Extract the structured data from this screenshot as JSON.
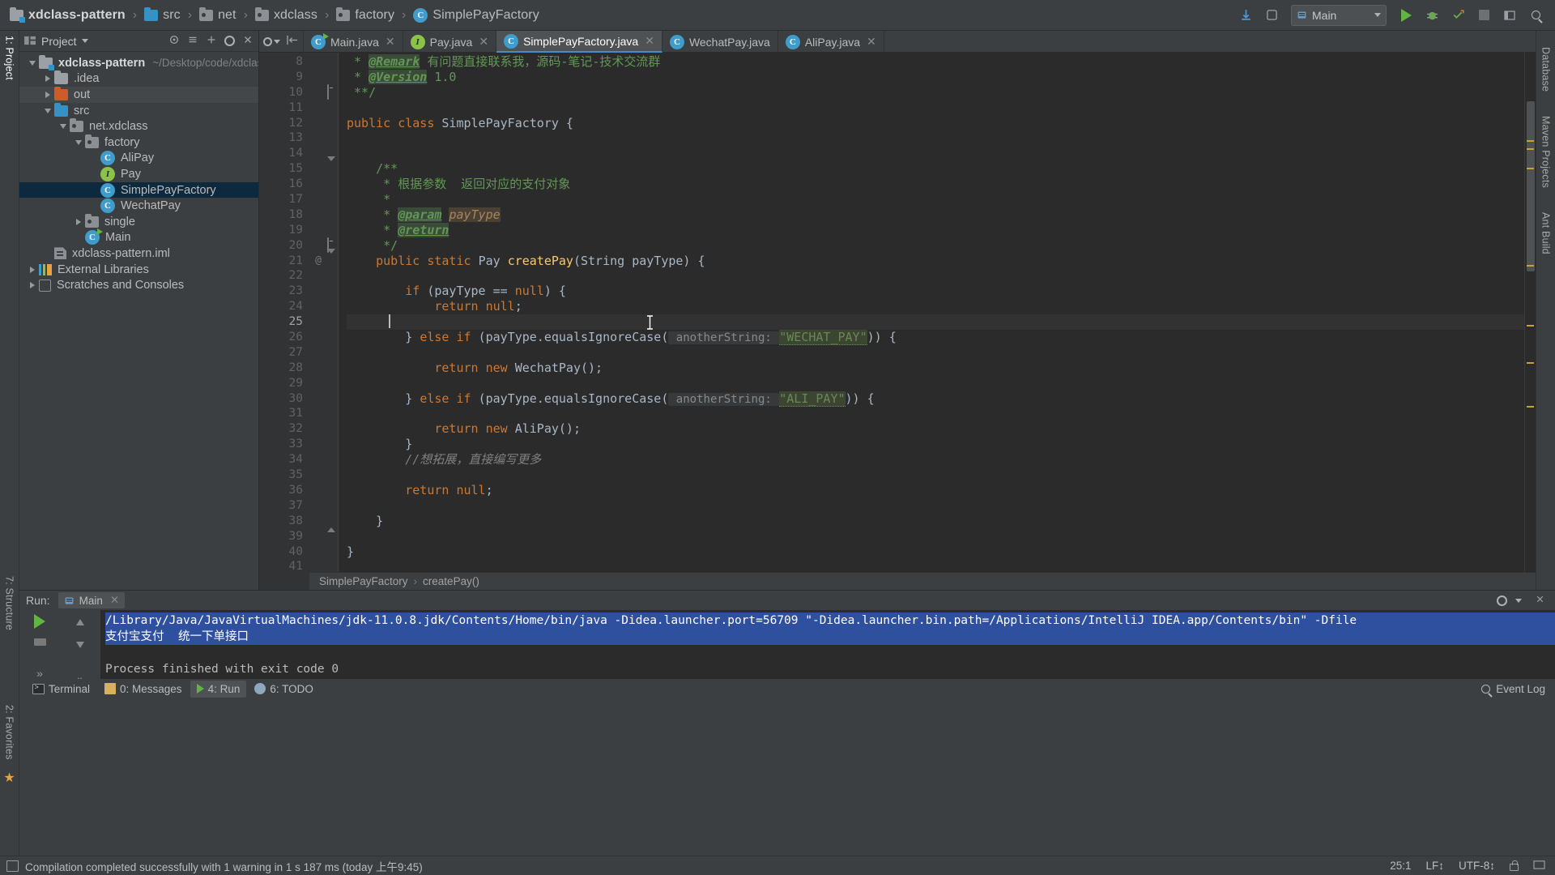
{
  "navbar": {
    "breadcrumbs": [
      {
        "label": "xdclass-pattern",
        "icon": "module-folder-icon"
      },
      {
        "label": "src",
        "icon": "source-folder-icon"
      },
      {
        "label": "net",
        "icon": "package-icon"
      },
      {
        "label": "xdclass",
        "icon": "package-icon"
      },
      {
        "label": "factory",
        "icon": "package-icon"
      },
      {
        "label": "SimplePayFactory",
        "icon": "class-icon"
      }
    ],
    "separator": "›",
    "run_config": "Main",
    "icons": [
      "update-project-icon",
      "vcs-icon",
      "run-icon",
      "debug-icon",
      "coverage-icon",
      "stop-icon",
      "layout-icon",
      "search-everywhere-icon"
    ]
  },
  "stripes": {
    "left": [
      "1: Project",
      "7: Structure",
      "2: Favorites"
    ],
    "right": [
      "Database",
      "Maven Projects",
      "Ant Build"
    ]
  },
  "project_panel": {
    "title": "Project",
    "tools": [
      "collapse-all-icon",
      "expand-icon",
      "settings-icon",
      "hide-icon"
    ],
    "tree": [
      {
        "label": "xdclass-pattern",
        "path": "~/Desktop/code/xdclass-patt",
        "icon": "module-folder-icon",
        "twisty": "down",
        "indent": 0,
        "bold": true,
        "state": "none"
      },
      {
        "label": ".idea",
        "icon": "folder-grey-icon",
        "twisty": "right",
        "indent": 1,
        "state": "none"
      },
      {
        "label": "out",
        "icon": "folder-orange-icon",
        "twisty": "right",
        "indent": 1,
        "state": "hover"
      },
      {
        "label": "src",
        "icon": "folder-blue-icon",
        "twisty": "down",
        "indent": 1,
        "state": "none"
      },
      {
        "label": "net.xdclass",
        "icon": "package-icon",
        "twisty": "down",
        "indent": 2,
        "state": "none"
      },
      {
        "label": "factory",
        "icon": "package-icon",
        "twisty": "down",
        "indent": 3,
        "state": "none"
      },
      {
        "label": "AliPay",
        "icon": "class-icon",
        "twisty": "none",
        "indent": 4,
        "state": "none"
      },
      {
        "label": "Pay",
        "icon": "interface-icon",
        "twisty": "none",
        "indent": 4,
        "state": "none"
      },
      {
        "label": "SimplePayFactory",
        "icon": "class-icon",
        "twisty": "none",
        "indent": 4,
        "state": "selected"
      },
      {
        "label": "WechatPay",
        "icon": "class-icon",
        "twisty": "none",
        "indent": 4,
        "state": "none"
      },
      {
        "label": "single",
        "icon": "package-icon",
        "twisty": "right",
        "indent": 3,
        "state": "none"
      },
      {
        "label": "Main",
        "icon": "class-runnable-icon",
        "twisty": "none",
        "indent": 3,
        "state": "none"
      },
      {
        "label": "xdclass-pattern.iml",
        "icon": "iml-file-icon",
        "twisty": "none",
        "indent": 1,
        "state": "none"
      },
      {
        "label": "External Libraries",
        "icon": "library-icon",
        "twisty": "right",
        "indent": 0,
        "state": "none"
      },
      {
        "label": "Scratches and Consoles",
        "icon": "scratch-icon",
        "twisty": "right",
        "indent": 0,
        "state": "none"
      }
    ]
  },
  "editor": {
    "tabs": [
      {
        "label": "Main.java",
        "icon": "class-runnable-icon",
        "active": false,
        "closable": true
      },
      {
        "label": "Pay.java",
        "icon": "interface-icon",
        "active": false,
        "closable": true
      },
      {
        "label": "SimplePayFactory.java",
        "icon": "class-icon",
        "active": true,
        "closable": true
      },
      {
        "label": "WechatPay.java",
        "icon": "class-icon",
        "active": false,
        "closable": false
      },
      {
        "label": "AliPay.java",
        "icon": "class-icon",
        "active": false,
        "closable": true
      }
    ],
    "first_line_number": 8,
    "lines": [
      {
        "n": 8,
        "annot": "",
        "fold": "",
        "tokens": [
          {
            "t": " * ",
            "c": "cmt"
          },
          {
            "t": "@Remark",
            "c": "cmt-tag"
          },
          {
            "t": " 有问题直接联系我，源码-笔记-技术交流群",
            "c": "cmt"
          }
        ]
      },
      {
        "n": 9,
        "annot": "",
        "fold": "",
        "tokens": [
          {
            "t": " * ",
            "c": "cmt"
          },
          {
            "t": "@Version",
            "c": "cmt-tag"
          },
          {
            "t": " 1.0",
            "c": "cmt"
          }
        ]
      },
      {
        "n": 10,
        "annot": "",
        "fold": "sq",
        "tokens": [
          {
            "t": " **/",
            "c": "cmt"
          }
        ]
      },
      {
        "n": 11,
        "annot": "",
        "fold": "",
        "tokens": []
      },
      {
        "n": 12,
        "annot": "",
        "fold": "",
        "tokens": [
          {
            "t": "public ",
            "c": "kw"
          },
          {
            "t": "class ",
            "c": "kw"
          },
          {
            "t": "SimplePayFactory",
            "c": "typ"
          },
          {
            "t": " {",
            "c": "typ"
          }
        ]
      },
      {
        "n": 13,
        "annot": "",
        "fold": "",
        "tokens": []
      },
      {
        "n": 14,
        "annot": "",
        "fold": "",
        "tokens": []
      },
      {
        "n": 15,
        "annot": "",
        "fold": "down",
        "tokens": [
          {
            "t": "    /**",
            "c": "cmt"
          }
        ]
      },
      {
        "n": 16,
        "annot": "",
        "fold": "",
        "tokens": [
          {
            "t": "     * 根据参数  返回对应的支付对象",
            "c": "cmt"
          }
        ]
      },
      {
        "n": 17,
        "annot": "",
        "fold": "",
        "tokens": [
          {
            "t": "     *",
            "c": "cmt"
          }
        ]
      },
      {
        "n": 18,
        "annot": "",
        "fold": "",
        "tokens": [
          {
            "t": "     * ",
            "c": "cmt"
          },
          {
            "t": "@param",
            "c": "cmt-tag"
          },
          {
            "t": " ",
            "c": "cmt"
          },
          {
            "t": "payType",
            "c": "cmt-param"
          }
        ]
      },
      {
        "n": 19,
        "annot": "",
        "fold": "",
        "tokens": [
          {
            "t": "     * ",
            "c": "cmt"
          },
          {
            "t": "@return",
            "c": "cmt-tag"
          }
        ]
      },
      {
        "n": 20,
        "annot": "",
        "fold": "sq",
        "tokens": [
          {
            "t": "     */",
            "c": "cmt"
          }
        ]
      },
      {
        "n": 21,
        "annot": "@",
        "fold": "down2",
        "tokens": [
          {
            "t": "    ",
            "c": "typ"
          },
          {
            "t": "public ",
            "c": "kw"
          },
          {
            "t": "static ",
            "c": "kw"
          },
          {
            "t": "Pay ",
            "c": "typ"
          },
          {
            "t": "createPay",
            "c": "mth"
          },
          {
            "t": "(",
            "c": "typ"
          },
          {
            "t": "String",
            "c": "typ"
          },
          {
            "t": " payType) {",
            "c": "typ"
          }
        ]
      },
      {
        "n": 22,
        "annot": "",
        "fold": "",
        "tokens": []
      },
      {
        "n": 23,
        "annot": "",
        "fold": "",
        "tokens": [
          {
            "t": "        ",
            "c": "typ"
          },
          {
            "t": "if ",
            "c": "kw"
          },
          {
            "t": "(payType == ",
            "c": "typ"
          },
          {
            "t": "null",
            "c": "kw"
          },
          {
            "t": ") {",
            "c": "typ"
          }
        ]
      },
      {
        "n": 24,
        "annot": "",
        "fold": "",
        "tokens": [
          {
            "t": "            ",
            "c": "typ"
          },
          {
            "t": "return null",
            "c": "kw"
          },
          {
            "t": ";",
            "c": "typ"
          }
        ]
      },
      {
        "n": 25,
        "annot": "",
        "fold": "",
        "tokens": [],
        "current": true
      },
      {
        "n": 26,
        "annot": "",
        "fold": "",
        "tokens": [
          {
            "t": "        } ",
            "c": "typ"
          },
          {
            "t": "else if ",
            "c": "kw"
          },
          {
            "t": "(payType.equalsIgnoreCase(",
            "c": "typ"
          },
          {
            "t": " anotherString: ",
            "c": "hint"
          },
          {
            "t": "\"WECHAT_PAY\"",
            "c": "str"
          },
          {
            "t": ")) {",
            "c": "typ"
          }
        ]
      },
      {
        "n": 27,
        "annot": "",
        "fold": "",
        "tokens": []
      },
      {
        "n": 28,
        "annot": "",
        "fold": "",
        "tokens": [
          {
            "t": "            ",
            "c": "typ"
          },
          {
            "t": "return new ",
            "c": "kw"
          },
          {
            "t": "WechatPay();",
            "c": "typ"
          }
        ]
      },
      {
        "n": 29,
        "annot": "",
        "fold": "",
        "tokens": []
      },
      {
        "n": 30,
        "annot": "",
        "fold": "",
        "tokens": [
          {
            "t": "        } ",
            "c": "typ"
          },
          {
            "t": "else if ",
            "c": "kw"
          },
          {
            "t": "(payType.equalsIgnoreCase(",
            "c": "typ"
          },
          {
            "t": " anotherString: ",
            "c": "hint"
          },
          {
            "t": "\"ALI_PAY\"",
            "c": "str"
          },
          {
            "t": ")) {",
            "c": "typ"
          }
        ]
      },
      {
        "n": 31,
        "annot": "",
        "fold": "",
        "tokens": []
      },
      {
        "n": 32,
        "annot": "",
        "fold": "",
        "tokens": [
          {
            "t": "            ",
            "c": "typ"
          },
          {
            "t": "return new ",
            "c": "kw"
          },
          {
            "t": "AliPay();",
            "c": "typ"
          }
        ]
      },
      {
        "n": 33,
        "annot": "",
        "fold": "",
        "tokens": [
          {
            "t": "        }",
            "c": "typ"
          }
        ]
      },
      {
        "n": 34,
        "annot": "",
        "fold": "",
        "tokens": [
          {
            "t": "        //想拓展，直接编写更多",
            "c": "lc"
          }
        ]
      },
      {
        "n": 35,
        "annot": "",
        "fold": "",
        "tokens": []
      },
      {
        "n": 36,
        "annot": "",
        "fold": "",
        "tokens": [
          {
            "t": "        ",
            "c": "typ"
          },
          {
            "t": "return null",
            "c": "kw"
          },
          {
            "t": ";",
            "c": "typ"
          }
        ]
      },
      {
        "n": 37,
        "annot": "",
        "fold": "",
        "tokens": []
      },
      {
        "n": 38,
        "annot": "",
        "fold": "up",
        "tokens": [
          {
            "t": "    }",
            "c": "typ"
          }
        ]
      },
      {
        "n": 39,
        "annot": "",
        "fold": "",
        "tokens": []
      },
      {
        "n": 40,
        "annot": "",
        "fold": "",
        "tokens": [
          {
            "t": "}",
            "c": "typ"
          }
        ]
      },
      {
        "n": 41,
        "annot": "",
        "fold": "",
        "tokens": []
      }
    ],
    "breadcrumb": [
      "SimplePayFactory",
      "createPay()"
    ],
    "breadcrumb_sep": "›"
  },
  "run_panel": {
    "label": "Run:",
    "tab": "Main",
    "console": [
      {
        "text": "/Library/Java/JavaVirtualMachines/jdk-11.0.8.jdk/Contents/Home/bin/java -Didea.launcher.port=56709 \"-Didea.launcher.bin.path=/Applications/IntelliJ IDEA.app/Contents/bin\" -Dfile",
        "selected": true
      },
      {
        "text": "支付宝支付  统一下单接口",
        "selected": true
      },
      {
        "text": "",
        "selected": false
      },
      {
        "text": "Process finished with exit code 0",
        "selected": false
      }
    ]
  },
  "bottom_bar": {
    "tabs": [
      {
        "label": "Terminal",
        "icon": "terminal-icon",
        "active": false,
        "mnemonic": ""
      },
      {
        "label": "0: Messages",
        "icon": "messages-icon",
        "active": false,
        "mnemonic": "0"
      },
      {
        "label": "4: Run",
        "icon": "run-icon",
        "active": true,
        "mnemonic": "4"
      },
      {
        "label": "6: TODO",
        "icon": "todo-icon",
        "active": false,
        "mnemonic": "6"
      }
    ],
    "event_log": "Event Log"
  },
  "status_bar": {
    "message": "Compilation completed successfully with 1 warning in 1 s 187 ms (today 上午9:45)",
    "caret": "25:1",
    "line_sep": "LF↕",
    "encoding": "UTF-8↕",
    "icons": [
      "memory-icon",
      "lock-icon"
    ]
  },
  "colors": {
    "bg_panel": "#3c3f41",
    "bg_editor": "#2b2b2b",
    "selection_blue": "#0d293e",
    "accent_blue": "#3592c4",
    "keyword_orange": "#cc7832",
    "string_green": "#6a8759",
    "comment_green": "#629755",
    "method_yellow": "#ffc66d",
    "console_sel": "#2f4f9f"
  }
}
